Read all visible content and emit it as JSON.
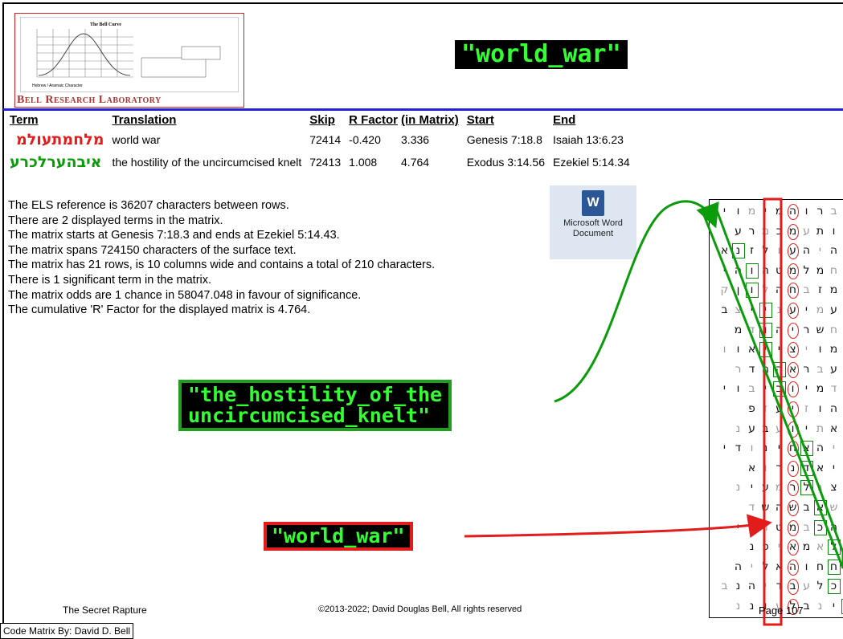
{
  "header": {
    "logo_title": "The Bell Curve",
    "logo_text": "Bell Research Laboratory",
    "logo_axis_caption": "Hebrew / Aramaic Character",
    "top_banner": "\"world_war\""
  },
  "table": {
    "headers": [
      "Term",
      "Translation",
      "Skip",
      "R Factor",
      "(in Matrix)",
      "Start",
      "End"
    ],
    "rows": [
      {
        "term": "מלחמתעולמ",
        "translation": "world war",
        "skip": "72414",
        "rfactor": "-0.420",
        "in_matrix": "3.336",
        "start": "Genesis 7:18.8",
        "end": "Isaiah 13:6.23"
      },
      {
        "term": "איבהערלכרע",
        "translation": "the hostility of the uncircumcised knelt",
        "skip": "72413",
        "rfactor": "1.008",
        "in_matrix": "4.764",
        "start": "Exodus 3:14.56",
        "end": "Ezekiel 5:14.34"
      }
    ]
  },
  "info_lines": [
    "The ELS reference is 36207 characters between rows.",
    "There are 2 displayed terms in the matrix.",
    "The matrix starts at Genesis 7:18.3 and ends at Ezekiel 5:14.43.",
    "The matrix spans 724150 characters of the surface text.",
    "The matrix has 21 rows, is 10 columns wide and contains a total of 210 characters.",
    "There is 1 significant term in the matrix.",
    "The matrix odds are 1 chance in 58047.048 in favour of significance.",
    "The cumulative 'R' Factor for the displayed matrix is 4.764."
  ],
  "word_icon": {
    "glyph": "W",
    "label_line1": "Microsoft Word",
    "label_line2": "Document"
  },
  "banners": {
    "mid_line1": "\"the_hostility_of_the",
    "mid_line2": "uncircumcised_knelt\"",
    "bottom": "\"world_war\""
  },
  "matrix": {
    "rows": [
      "גברו*מימוי",
      "שותעמכמרעו",
      "אהיהעולזנא",
      "בחמלמטהוהי",
      "המזבחהלוןק",
      "נעמיענייצב",
      "לחשריהודמ",
      "ימויצייאוו",
      "תעבראההדר",
      "אדמיוביבוי",
      "עהוזיעזפ",
      "טאתיועבענ",
      "ניהצחינודי",
      "איאדנרוא",
      "רצגלרמעינ",
      "אשאבשהשד",
      "והכבמטדיי",
      "ולאמאיפנ",
      "תחחוהאליה",
      "תכלעבדיהנב",
      "נינבלעוננ"
    ]
  },
  "footer": {
    "left": "The Secret Rapture",
    "center": "©2013-2022; David Douglas Bell, All rights reserved",
    "right": "Page 107",
    "credit": "Code Matrix By: David D. Bell"
  },
  "colors": {
    "red": "#e21b1b",
    "green": "#0a9c0a",
    "blue_rule": "#2222dd",
    "banner_text": "#33ff33"
  }
}
